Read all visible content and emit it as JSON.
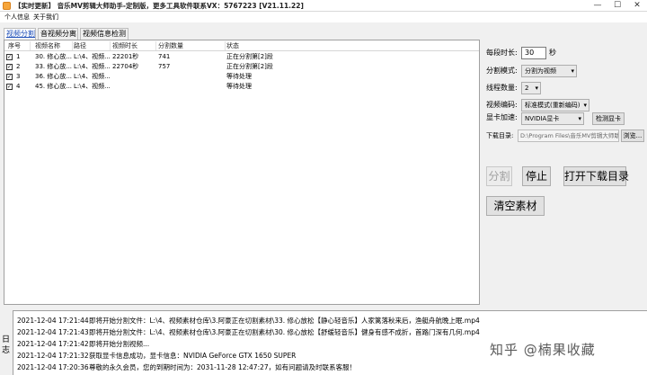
{
  "window": {
    "title": "【实时更新】 音乐MV剪辑大师助手-定制版，更多工具软件联系VX：5767223 [V21.11.22]",
    "min": "—",
    "max": "☐",
    "close": "✕"
  },
  "menu": {
    "items": [
      {
        "label": "个人信息"
      },
      {
        "label": "关于我们"
      }
    ]
  },
  "tabs": [
    {
      "label": "视频分割",
      "active": true
    },
    {
      "label": "音视频分离",
      "active": false
    },
    {
      "label": "视频信息检测",
      "active": false
    }
  ],
  "table": {
    "headers": [
      "序号",
      "视频名称",
      "路径",
      "视频时长",
      "分割数量",
      "状态"
    ],
    "rows": [
      {
        "checked": "✓",
        "index": "1",
        "name": "30. 修心放...",
        "path": "L:\\4、视频...",
        "duration": "22201秒",
        "count": "741",
        "status": "正在分割第[2]段"
      },
      {
        "checked": "✓",
        "index": "2",
        "name": "33. 修心放...",
        "path": "L:\\4、视频...",
        "duration": "22704秒",
        "count": "757",
        "status": "正在分割第[2]段"
      },
      {
        "checked": "✓",
        "index": "3",
        "name": "36. 修心放...",
        "path": "L:\\4、视频...",
        "duration": "",
        "count": "",
        "status": "等待处理"
      },
      {
        "checked": "✓",
        "index": "4",
        "name": "45. 修心放...",
        "path": "L:\\4、视频...",
        "duration": "",
        "count": "",
        "status": "等待处理"
      }
    ]
  },
  "settings": {
    "segment_label": "每段时长:",
    "segment_value": "30",
    "segment_unit": "秒",
    "mode_label": "分割模式:",
    "mode_value": "分割为视频",
    "threads_label": "线程数量:",
    "threads_value": "2",
    "codec_label": "视频编码:",
    "codec_value": "标准模式(重新编码)",
    "gpu_label": "显卡加速:",
    "gpu_value": "NVIDIA显卡",
    "detect_gpu_button": "检测显卡",
    "download_label": "下载目录:",
    "download_path": "D:\\Program Files\\音乐MV剪辑大师助",
    "browse_button": "浏览..."
  },
  "actions": {
    "split": "分割",
    "stop": "停止",
    "open_dir": "打开下载目录",
    "clear": "清空素材"
  },
  "log": {
    "label_chars": [
      "日",
      "志"
    ],
    "lines": [
      {
        "time": "2021-12-04 17:21:44",
        "msg": "即将开始分割文件：L:\\4、视频素材仓库\\3.阿豪正在切割素材\\33. 修心放松【静心轻音乐】人家篱落秋来后，渔艇舟航晚上眠.mp4"
      },
      {
        "time": "2021-12-04 17:21:43",
        "msg": "即将开始分割文件：L:\\4、视频素材仓库\\3.阿豪正在切割素材\\30. 修心放松【舒缓轻音乐】健身有感不成折，首路门深有几何.mp4"
      },
      {
        "time": "2021-12-04 17:21:42",
        "msg": "即将开始分割视频..."
      },
      {
        "time": "2021-12-04 17:21:32",
        "msg": "获取显卡信息成功，显卡信息：NVIDIA GeForce GTX 1650 SUPER"
      },
      {
        "time": "2021-12-04 17:20:36",
        "msg": "尊敬的永久会员，您的到期时间为：2031-11-28 12:47:27，如有问题请及时联系客服！"
      }
    ]
  },
  "watermark": "知乎 @楠果收藏"
}
